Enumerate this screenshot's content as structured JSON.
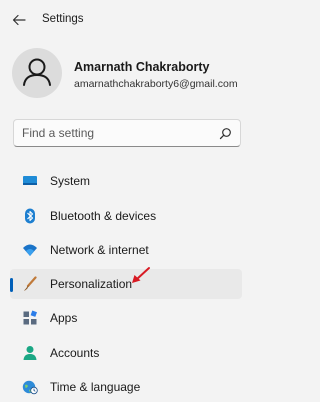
{
  "window": {
    "title": "Settings"
  },
  "profile": {
    "name": "Amarnath Chakraborty",
    "email": "amarnathchakraborty6@gmail.com"
  },
  "search": {
    "placeholder": "Find a setting",
    "value": ""
  },
  "nav": {
    "selected": "Personalization",
    "items": [
      {
        "label": "System",
        "icon": "display-icon"
      },
      {
        "label": "Bluetooth & devices",
        "icon": "bluetooth-icon"
      },
      {
        "label": "Network & internet",
        "icon": "wifi-icon"
      },
      {
        "label": "Personalization",
        "icon": "brush-icon"
      },
      {
        "label": "Apps",
        "icon": "apps-icon"
      },
      {
        "label": "Accounts",
        "icon": "person-icon"
      },
      {
        "label": "Time & language",
        "icon": "globe-clock-icon"
      }
    ]
  },
  "colors": {
    "accent": "#005fb8",
    "background": "#f3f3f3",
    "selected_bg": "#e9e9e9",
    "annotation": "#d81b24"
  }
}
